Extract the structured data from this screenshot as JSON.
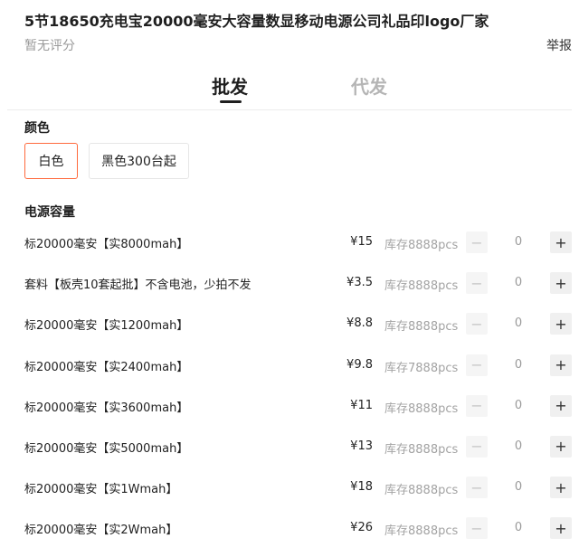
{
  "product": {
    "title": "5节18650充电宝20000毫安大容量数显移动电源公司礼品印logo厂家",
    "rating_text": "暂无评分",
    "report_label": "举报"
  },
  "tabs": {
    "wholesale": "批发",
    "dropship": "代发",
    "active": "wholesale"
  },
  "color_section": {
    "label": "颜色",
    "options": [
      "白色",
      "黑色300台起"
    ],
    "selected": "白色"
  },
  "capacity_section": {
    "label": "电源容量",
    "rows": [
      {
        "name": "标20000毫安【实8000mah】",
        "price": "¥15",
        "stock": "库存8888pcs",
        "qty": "0"
      },
      {
        "name": "套料【板壳10套起批】不含电池，少拍不发",
        "price": "¥3.5",
        "stock": "库存8888pcs",
        "qty": "0"
      },
      {
        "name": "标20000毫安【实1200mah】",
        "price": "¥8.8",
        "stock": "库存8888pcs",
        "qty": "0"
      },
      {
        "name": "标20000毫安【实2400mah】",
        "price": "¥9.8",
        "stock": "库存7888pcs",
        "qty": "0"
      },
      {
        "name": "标20000毫安【实3600mah】",
        "price": "¥11",
        "stock": "库存8888pcs",
        "qty": "0"
      },
      {
        "name": "标20000毫安【实5000mah】",
        "price": "¥13",
        "stock": "库存8888pcs",
        "qty": "0"
      },
      {
        "name": "标20000毫安【实1Wmah】",
        "price": "¥18",
        "stock": "库存8888pcs",
        "qty": "0"
      },
      {
        "name": "标20000毫安【实2Wmah】",
        "price": "¥26",
        "stock": "库存8888pcs",
        "qty": "0"
      }
    ]
  },
  "icons": {
    "minus": "minus-icon",
    "plus": "plus-icon"
  },
  "colors": {
    "accent": "#ff6a3d",
    "muted_text": "#a3a3a3"
  }
}
